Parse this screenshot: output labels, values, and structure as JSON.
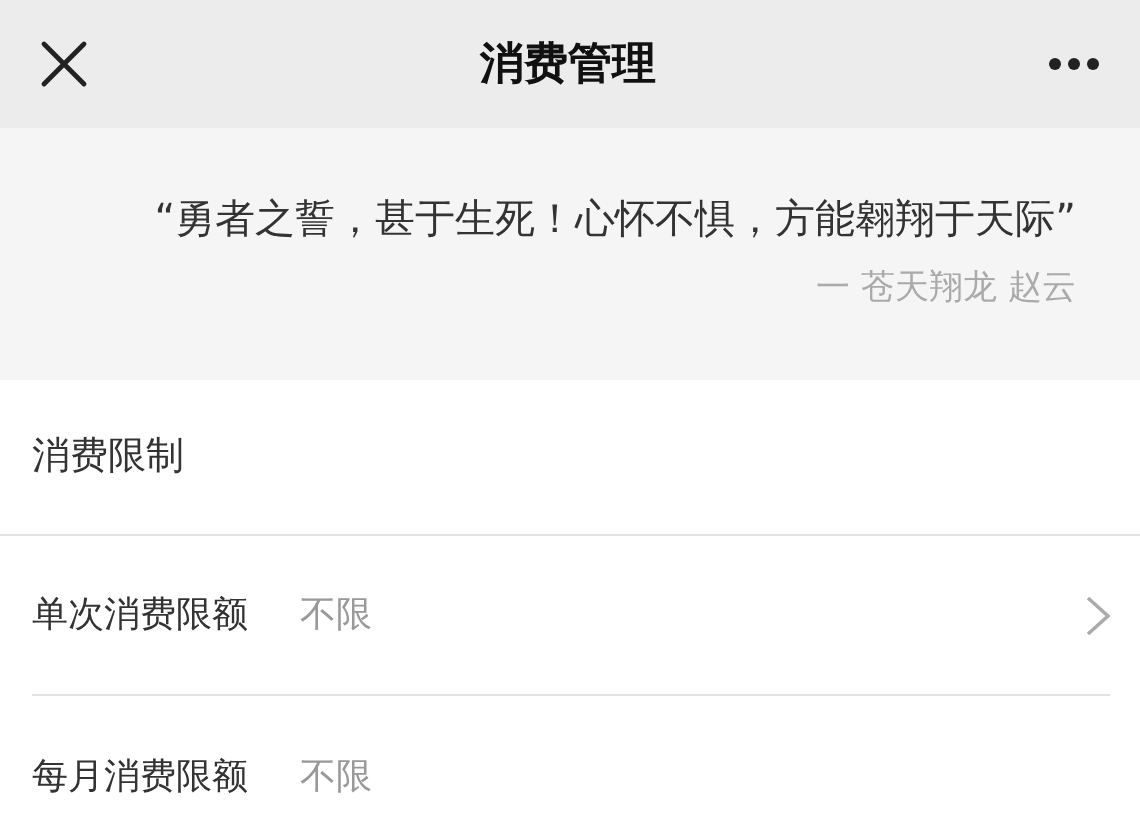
{
  "nav_bar": {
    "title": "消费管理"
  },
  "quote": {
    "text": "“勇者之誓，甚于生死！心怀不惧，方能翱翔于天际”",
    "attribution": "一 苍天翔龙 赵云"
  },
  "section": {
    "title": "消费限制"
  },
  "rows": [
    {
      "label": "单次消费限额",
      "value": "不限",
      "chevron": true
    },
    {
      "label": "每月消费限额",
      "value": "不限",
      "chevron": false
    }
  ]
}
